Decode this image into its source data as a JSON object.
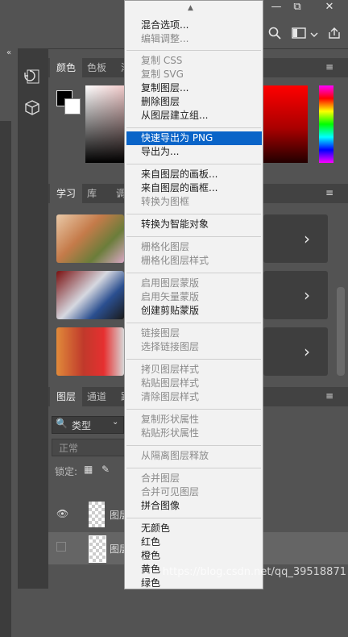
{
  "top_bar": {
    "win_minimize": "—",
    "win_restore": "⧉",
    "win_close": "✕",
    "icons": [
      "search-icon",
      "workspace-icon",
      "share-icon"
    ]
  },
  "panels": {
    "color_tabs": [
      "颜色",
      "色板",
      "渐"
    ],
    "learn_tabs": [
      "学习",
      "库",
      "调"
    ],
    "layers_tabs": [
      "图层",
      "通道",
      "路"
    ],
    "layer_filter": "类型",
    "blend_mode": "正常",
    "lock_label": "锁定:",
    "layer_names": [
      "图层",
      "图层"
    ]
  },
  "menu": {
    "items": [
      {
        "label": "混合选项...",
        "disabled": false
      },
      {
        "label": "编辑调整...",
        "disabled": true
      },
      {
        "label": "复制 CSS",
        "disabled": true
      },
      {
        "label": "复制 SVG",
        "disabled": true
      },
      {
        "label": "复制图层...",
        "disabled": false
      },
      {
        "label": "删除图层",
        "disabled": false
      },
      {
        "label": "从图层建立组...",
        "disabled": false
      },
      {
        "label": "快速导出为 PNG",
        "disabled": false,
        "highlighted": true
      },
      {
        "label": "导出为...",
        "disabled": false
      },
      {
        "label": "来自图层的画板...",
        "disabled": false
      },
      {
        "label": "来自图层的画框...",
        "disabled": false
      },
      {
        "label": "转换为图框",
        "disabled": true
      },
      {
        "label": "转换为智能对象",
        "disabled": false
      },
      {
        "label": "栅格化图层",
        "disabled": true
      },
      {
        "label": "栅格化图层样式",
        "disabled": true
      },
      {
        "label": "启用图层蒙版",
        "disabled": true
      },
      {
        "label": "启用矢量蒙版",
        "disabled": true
      },
      {
        "label": "创建剪贴蒙版",
        "disabled": false
      },
      {
        "label": "链接图层",
        "disabled": true
      },
      {
        "label": "选择链接图层",
        "disabled": true
      },
      {
        "label": "拷贝图层样式",
        "disabled": true
      },
      {
        "label": "粘贴图层样式",
        "disabled": true
      },
      {
        "label": "清除图层样式",
        "disabled": true
      },
      {
        "label": "复制形状属性",
        "disabled": true
      },
      {
        "label": "粘贴形状属性",
        "disabled": true
      },
      {
        "label": "从隔离图层释放",
        "disabled": true
      },
      {
        "label": "合并图层",
        "disabled": true
      },
      {
        "label": "合并可见图层",
        "disabled": true
      },
      {
        "label": "拼合图像",
        "disabled": false
      },
      {
        "label": "无颜色",
        "disabled": false
      },
      {
        "label": "红色",
        "disabled": false
      },
      {
        "label": "橙色",
        "disabled": false
      },
      {
        "label": "黄色",
        "disabled": false
      },
      {
        "label": "绿色",
        "disabled": false
      }
    ]
  },
  "watermark": "https://blog.csdn.net/qq_39518871",
  "colors": {
    "menu_highlight": "#0a64c8",
    "panel_bg": "#535353",
    "panel_dark": "#3c3c3c"
  }
}
